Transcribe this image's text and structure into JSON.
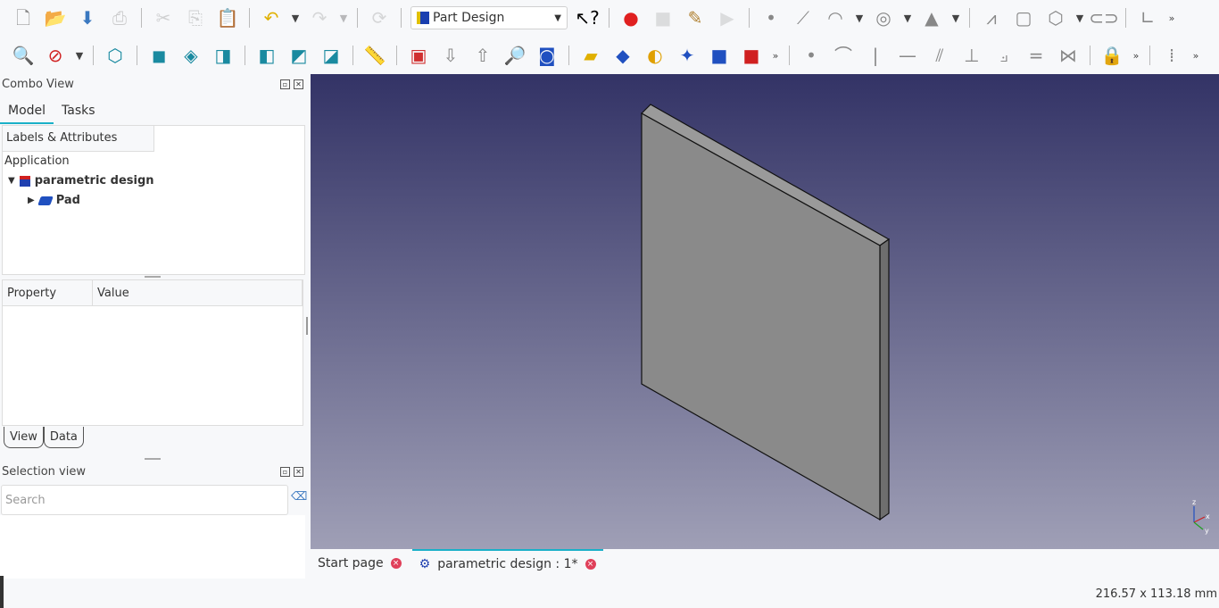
{
  "toolbar1": [
    {
      "n": "new-file-icon",
      "g": "🗋",
      "c": "#888"
    },
    {
      "n": "open-file-icon",
      "g": "📂",
      "c": "#4a7bc0"
    },
    {
      "n": "save-icon",
      "g": "⬇",
      "c": "#3a78c0"
    },
    {
      "n": "print-icon",
      "g": "⎙",
      "c": "#777",
      "d": 1
    },
    "sep",
    {
      "n": "cut-icon",
      "g": "✂",
      "c": "#888",
      "d": 1
    },
    {
      "n": "copy-icon",
      "g": "⎘",
      "c": "#888",
      "d": 1
    },
    {
      "n": "paste-icon",
      "g": "📋",
      "c": "#888"
    },
    "sep",
    {
      "n": "undo-icon",
      "g": "↶",
      "c": "#e0b000"
    },
    {
      "n": "undo-dropdown-icon",
      "g": "▼",
      "s": 1
    },
    {
      "n": "redo-icon",
      "g": "↷",
      "c": "#999",
      "d": 1
    },
    {
      "n": "redo-dropdown-icon",
      "g": "▼",
      "s": 1,
      "d": 1
    },
    "sep",
    {
      "n": "refresh-icon",
      "g": "⟳",
      "c": "#999",
      "d": 1
    },
    "sep",
    "wb",
    {
      "n": "whats-this-icon",
      "g": "↖?",
      "c": "#000"
    },
    "sep",
    {
      "n": "macro-record-icon",
      "g": "●",
      "c": "#e02020"
    },
    {
      "n": "macro-stop-icon",
      "g": "■",
      "c": "#aaa",
      "d": 1
    },
    {
      "n": "macro-edit-icon",
      "g": "✎",
      "c": "#b08030"
    },
    {
      "n": "macro-play-icon",
      "g": "▶",
      "c": "#aaa",
      "d": 1
    },
    "sep",
    {
      "n": "sketch-point-icon",
      "g": "•",
      "c": "#888"
    },
    {
      "n": "sketch-line-icon",
      "g": "⟋",
      "c": "#888"
    },
    {
      "n": "sketch-arc-icon",
      "g": "◠",
      "c": "#888"
    },
    {
      "n": "arc-dropdown-icon",
      "g": "▼",
      "s": 1
    },
    {
      "n": "sketch-circle-icon",
      "g": "◎",
      "c": "#888"
    },
    {
      "n": "circle-dropdown-icon",
      "g": "▼",
      "s": 1
    },
    {
      "n": "sketch-conic-icon",
      "g": "▲",
      "c": "#888"
    },
    {
      "n": "conic-dropdown-icon",
      "g": "▼",
      "s": 1
    },
    "sep",
    {
      "n": "sketch-polyline-icon",
      "g": "⩘",
      "c": "#888"
    },
    {
      "n": "sketch-rectangle-icon",
      "g": "▢",
      "c": "#888"
    },
    {
      "n": "sketch-polygon-icon",
      "g": "⬡",
      "c": "#888"
    },
    {
      "n": "polygon-dropdown-icon",
      "g": "▼",
      "s": 1
    },
    {
      "n": "sketch-slot-icon",
      "g": "⊂⊃",
      "c": "#888"
    },
    "sep",
    {
      "n": "sketch-fillet-icon",
      "g": "∟",
      "c": "#888"
    },
    {
      "n": "more-tools-icon",
      "g": "»",
      "s": 1
    }
  ],
  "toolbar2": [
    {
      "n": "fit-all-icon",
      "g": "🔍",
      "c": "#1a80a0"
    },
    {
      "n": "draw-style-icon",
      "g": "⊘",
      "c": "#d02020"
    },
    {
      "n": "draw-style-dropdown-icon",
      "g": "▼",
      "s": 1
    },
    "sep",
    {
      "n": "view-isometric-icon",
      "g": "⬡",
      "c": "#1a8aa0"
    },
    "sep",
    {
      "n": "view-front-icon",
      "g": "◼",
      "c": "#1a8aa0"
    },
    {
      "n": "view-top-icon",
      "g": "◈",
      "c": "#1a8aa0"
    },
    {
      "n": "view-right-icon",
      "g": "◨",
      "c": "#1a8aa0"
    },
    "sep",
    {
      "n": "view-rear-icon",
      "g": "◧",
      "c": "#1a8aa0"
    },
    {
      "n": "view-bottom-icon",
      "g": "◩",
      "c": "#1a8aa0"
    },
    {
      "n": "view-left-icon",
      "g": "◪",
      "c": "#1a8aa0"
    },
    "sep",
    {
      "n": "measure-icon",
      "g": "📏",
      "c": "#1a6a80"
    },
    "sep",
    {
      "n": "create-body-icon",
      "g": "▣",
      "c": "#d03030"
    },
    {
      "n": "export-icon",
      "g": "⇩",
      "c": "#888"
    },
    {
      "n": "import-icon",
      "g": "⇧",
      "c": "#888"
    },
    {
      "n": "preview-icon",
      "g": "🔎",
      "c": "#888"
    },
    {
      "n": "create-sketch-icon",
      "g": "◙",
      "c": "#2050c0"
    },
    "sep",
    {
      "n": "pad-icon",
      "g": "▰",
      "c": "#e0b000"
    },
    {
      "n": "pocket-icon",
      "g": "◆",
      "c": "#2050c0"
    },
    {
      "n": "revolution-icon",
      "g": "◐",
      "c": "#e0a000"
    },
    {
      "n": "groove-icon",
      "g": "✦",
      "c": "#2050c0"
    },
    {
      "n": "additive-primitive-icon",
      "g": "■",
      "c": "#2050c0"
    },
    {
      "n": "subtractive-primitive-icon",
      "g": "■",
      "c": "#d02020"
    },
    {
      "n": "more-partdesign-icon",
      "g": "»",
      "s": 1
    },
    "sep",
    {
      "n": "constraint-coincident-icon",
      "g": "•",
      "c": "#888"
    },
    {
      "n": "constraint-point-on-object-icon",
      "g": "⌒",
      "c": "#888"
    },
    {
      "n": "constraint-vertical-icon",
      "g": "|",
      "c": "#888"
    },
    {
      "n": "constraint-horizontal-icon",
      "g": "—",
      "c": "#888"
    },
    {
      "n": "constraint-parallel-icon",
      "g": "⫽",
      "c": "#888"
    },
    {
      "n": "constraint-perpendicular-icon",
      "g": "⊥",
      "c": "#888"
    },
    {
      "n": "constraint-tangent-icon",
      "g": "⟓",
      "c": "#888"
    },
    {
      "n": "constraint-equal-icon",
      "g": "=",
      "c": "#888"
    },
    {
      "n": "constraint-symmetric-icon",
      "g": "⋈",
      "c": "#888"
    },
    "sep",
    {
      "n": "constraint-lock-icon",
      "g": "🔒",
      "c": "#888"
    },
    {
      "n": "more-constraints-icon",
      "g": "»",
      "s": 1
    },
    "sep",
    {
      "n": "toggle-construction-icon",
      "g": "⁞",
      "c": "#888"
    },
    {
      "n": "more-sketcher-icon",
      "g": "»",
      "s": 1
    }
  ],
  "workbench": {
    "label": "Part Design"
  },
  "combo": {
    "title": "Combo View",
    "tabs": [
      "Model",
      "Tasks"
    ],
    "tree_header": "Labels & Attributes",
    "root": "Application",
    "document": "parametric design",
    "feature": "Pad"
  },
  "props": {
    "col1": "Property",
    "col2": "Value",
    "tabs": [
      "View",
      "Data"
    ]
  },
  "selection": {
    "title": "Selection view",
    "search_placeholder": "Search"
  },
  "doc_tabs": [
    "Start page",
    "parametric design : 1*"
  ],
  "status": {
    "dimensions": "216.57 x 113.18 mm"
  },
  "colors": {
    "accent": "#1ab0c8",
    "view_top": "#333366",
    "view_bottom": "#9f9fb6"
  }
}
